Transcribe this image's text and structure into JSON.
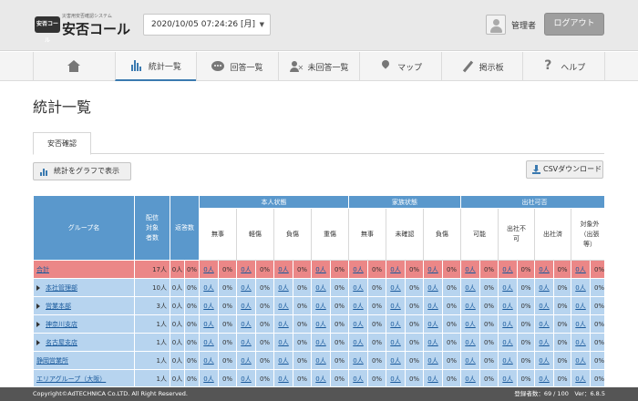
{
  "header": {
    "logo_badge": "安否コール",
    "logo_sub": "災害用安否確認システム",
    "logo_main": "安否コール",
    "datetime": "2020/10/05 07:24:26 [月]",
    "user_name": "管理者",
    "logout_label": "ログアウト"
  },
  "nav": {
    "items": [
      {
        "label": "",
        "icon": "home-icon"
      },
      {
        "label": "統計一覧",
        "icon": "bar-chart-icon"
      },
      {
        "label": "回答一覧",
        "icon": "chat-icon"
      },
      {
        "label": "未回答一覧",
        "icon": "person-x-icon"
      },
      {
        "label": "マップ",
        "icon": "map-pin-icon"
      },
      {
        "label": "掲示板",
        "icon": "pencil-icon"
      },
      {
        "label": "ヘルプ",
        "icon": "question-icon"
      }
    ]
  },
  "page": {
    "title": "統計一覧",
    "tab": "安否確認",
    "graph_button": "統計をグラフで表示",
    "csv_button": "CSVダウンロード"
  },
  "table": {
    "group_header": "グループ名",
    "target_header": "配信対象者数",
    "reply_header": "返答数",
    "sections": [
      "本人状態",
      "家族状態",
      "出社可否"
    ],
    "sub": [
      "無事",
      "軽傷",
      "負傷",
      "重傷",
      "無事",
      "未確認",
      "負傷",
      "可能",
      "出社不可",
      "出社済",
      "対象外（出張等）"
    ],
    "rows": [
      {
        "name": "合計",
        "total": true,
        "arrow": false,
        "target": "17人",
        "reply": "0人",
        "reply_pct": "0%"
      },
      {
        "name": "本社管理部",
        "total": false,
        "arrow": true,
        "target": "10人",
        "reply": "0人",
        "reply_pct": "0%"
      },
      {
        "name": "営業本部",
        "total": false,
        "arrow": true,
        "target": "3人",
        "reply": "0人",
        "reply_pct": "0%"
      },
      {
        "name": "神奈川支店",
        "total": false,
        "arrow": true,
        "target": "1人",
        "reply": "0人",
        "reply_pct": "0%"
      },
      {
        "name": "名古屋支店",
        "total": false,
        "arrow": true,
        "target": "1人",
        "reply": "0人",
        "reply_pct": "0%"
      },
      {
        "name": "静岡営業所",
        "total": false,
        "arrow": false,
        "target": "1人",
        "reply": "0人",
        "reply_pct": "0%"
      },
      {
        "name": "エリアグループ（大阪）",
        "total": false,
        "arrow": false,
        "target": "1人",
        "reply": "0人",
        "reply_pct": "0%"
      }
    ],
    "cell_count": "0人",
    "cell_pct": "0%"
  },
  "footer": {
    "copyright": "Copyright©AdTECHNICA Co.LTD. All Right Reserved.",
    "stats": "登録者数：69 / 100　Ver：6.8.5"
  }
}
